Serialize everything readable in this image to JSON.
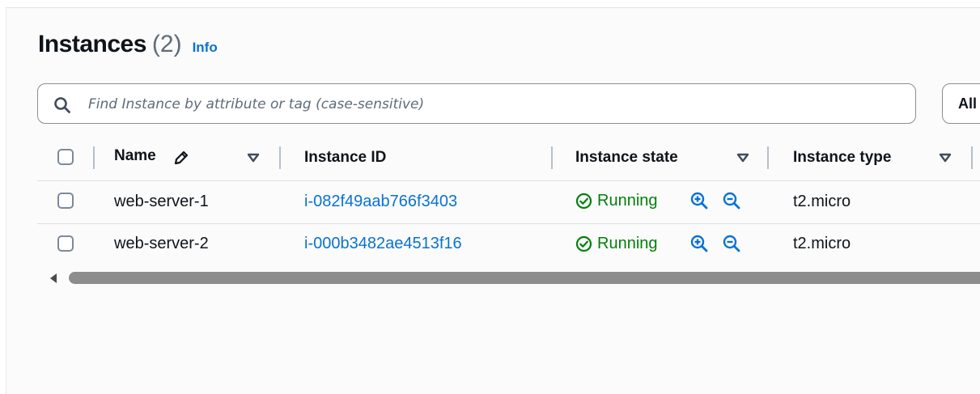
{
  "header": {
    "title": "Instances",
    "count": "(2)",
    "info_link": "Info"
  },
  "search": {
    "placeholder": "Find Instance by attribute or tag (case-sensitive)",
    "value": ""
  },
  "filter": {
    "selected": "All"
  },
  "columns": [
    {
      "label": "Name"
    },
    {
      "label": "Instance ID"
    },
    {
      "label": "Instance state"
    },
    {
      "label": "Instance type"
    }
  ],
  "rows": [
    {
      "name": "web-server-1",
      "instance_id": "i-082f49aab766f3403",
      "state": "Running",
      "type": "t2.micro"
    },
    {
      "name": "web-server-2",
      "instance_id": "i-000b3482ae4513f16",
      "state": "Running",
      "type": "t2.micro"
    }
  ],
  "icons": {
    "search": "search-icon",
    "edit": "pencil-icon",
    "sort": "caret-down-icon",
    "status": "check-circle-icon",
    "zoom_in": "zoom-in-icon",
    "zoom_out": "zoom-out-icon",
    "scroll_left": "scroll-left-icon"
  },
  "colors": {
    "link": "#0972d3",
    "success": "#037f0c",
    "text": "#0f141a",
    "muted": "#5f6b7a"
  }
}
